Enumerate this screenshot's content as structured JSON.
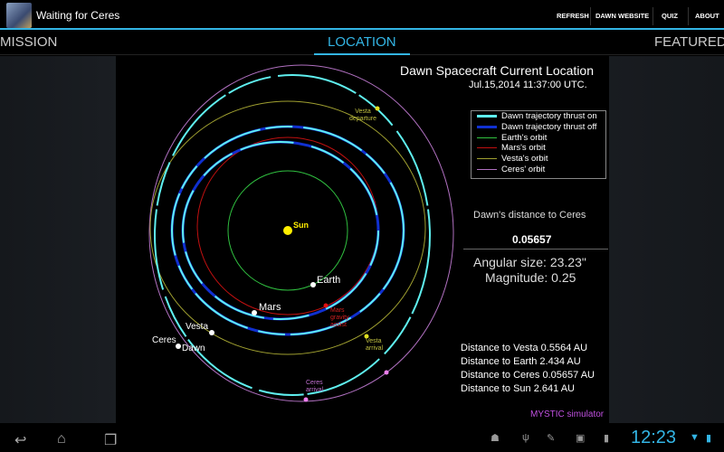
{
  "app": {
    "title": "Waiting for Ceres",
    "actions": [
      "REFRESH",
      "DAWN WEBSITE",
      "QUIZ",
      "ABOUT"
    ]
  },
  "tabs": {
    "left": "MISSION",
    "active": "LOCATION",
    "right": "FEATURED"
  },
  "view": {
    "title": "Dawn Spacecraft Current Location",
    "timestamp": "Jul.15,2014 11:37:00 UTC.",
    "legend": [
      {
        "label": "Dawn trajectory thrust on",
        "color": "#5ff0f0"
      },
      {
        "label": "Dawn trajectory thrust off",
        "color": "#1030d0"
      },
      {
        "label": "Earth's orbit",
        "color": "#30c040"
      },
      {
        "label": "Mars's orbit",
        "color": "#c01010"
      },
      {
        "label": "Vesta's orbit",
        "color": "#a0a030"
      },
      {
        "label": "Ceres' orbit",
        "color": "#b070c0"
      }
    ],
    "distance_label": "Dawn's distance to Ceres",
    "distance_value": "0.05657",
    "angular_size": "Angular size: 23.23\"",
    "magnitude": "Magnitude: 0.25",
    "distances": [
      "Distance to Vesta 0.5564 AU",
      "Distance to Earth 2.434 AU",
      "Distance to Ceres 0.05657 AU",
      "Distance to Sun 2.641 AU"
    ],
    "credit": "MYSTIC simulator",
    "labels": {
      "sun": "Sun",
      "earth": "Earth",
      "mars": "Mars",
      "vesta": "Vesta",
      "ceres": "Ceres",
      "dawn": "Dawn",
      "vesta_departure": [
        "Vesta",
        "departure"
      ],
      "mars_assist": [
        "Mars",
        "gravity",
        "assist"
      ],
      "vesta_arrival": [
        "Vesta",
        "arrival"
      ],
      "ceres_arrival": [
        "Ceres",
        "arrival"
      ]
    }
  },
  "status": {
    "time": "12:23"
  }
}
